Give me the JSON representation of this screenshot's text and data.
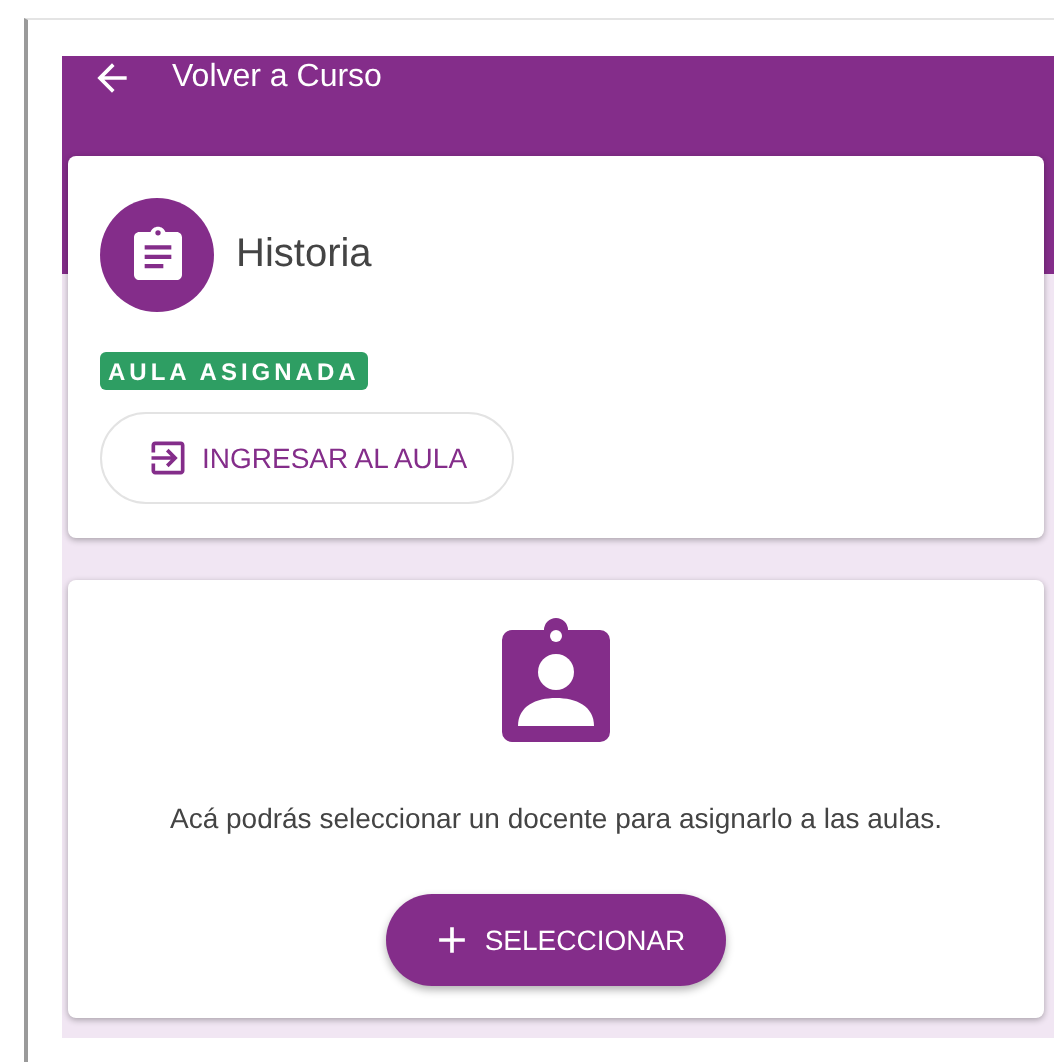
{
  "header": {
    "back_label": "Volver a Curso"
  },
  "course": {
    "title": "Historia",
    "badge": "AULA ASIGNADA",
    "enter_button": "INGRESAR AL AULA"
  },
  "teacher": {
    "message": "Acá podrás seleccionar un docente para asignarlo a las aulas.",
    "select_button": "SELECCIONAR"
  }
}
